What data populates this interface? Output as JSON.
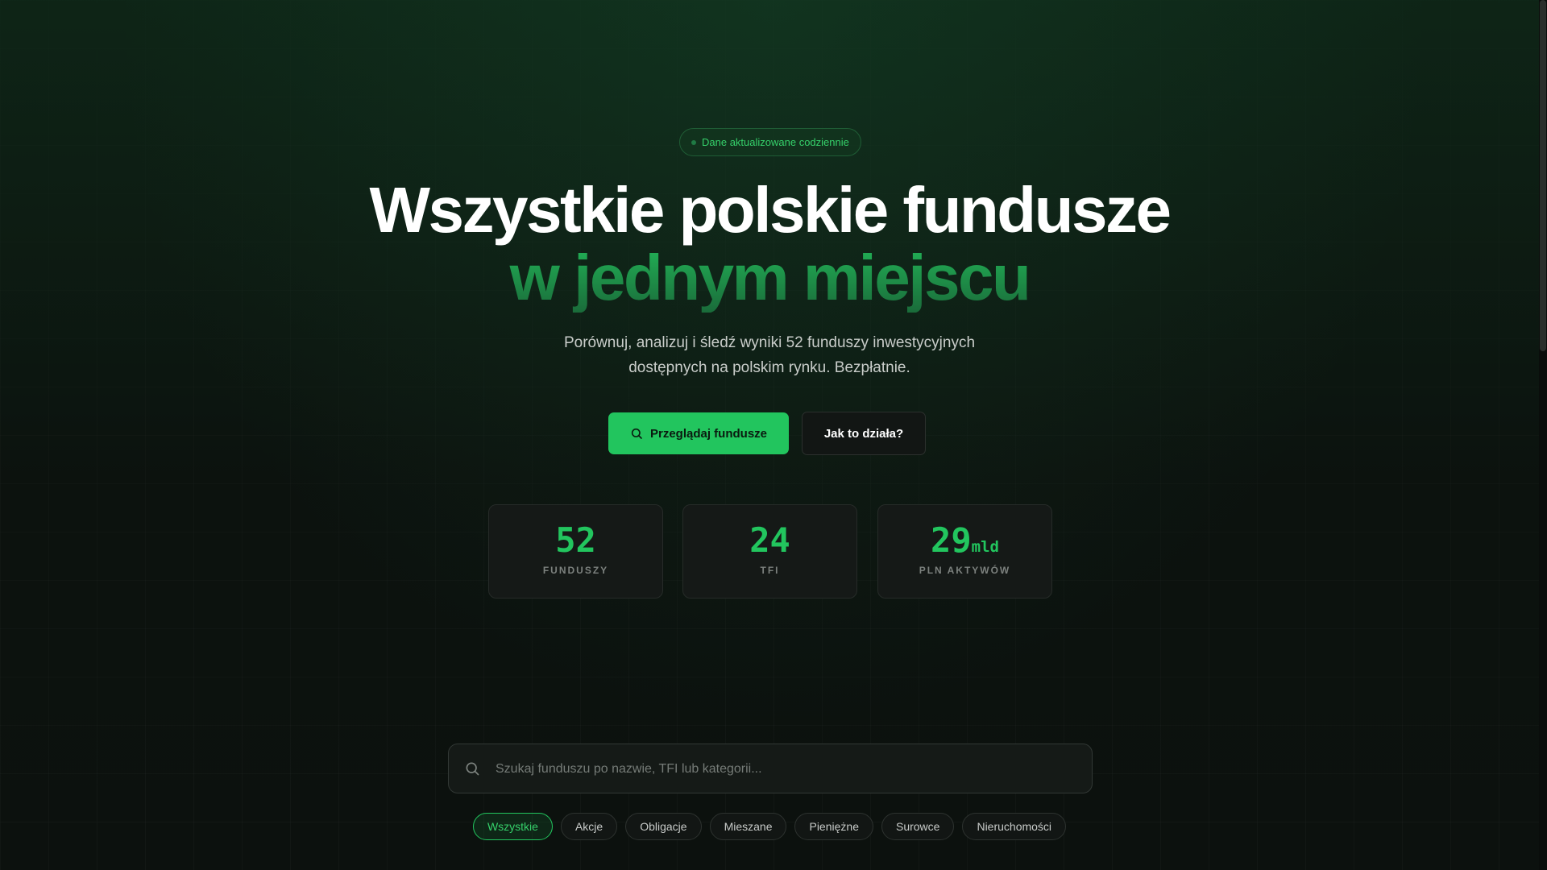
{
  "badge": {
    "text": "Dane aktualizowane codziennie"
  },
  "hero": {
    "title_line1": "Wszystkie polskie fundusze",
    "title_line2": "w jednym miejscu",
    "subtitle_line1": "Porównuj, analizuj i śledź wyniki 52 funduszy inwestycyjnych",
    "subtitle_line2": "dostępnych na polskim rynku. Bezpłatnie."
  },
  "buttons": {
    "primary_label": "Przeglądaj fundusze",
    "secondary_label": "Jak to działa?"
  },
  "stats": [
    {
      "value": "52",
      "unit": "",
      "label": "FUNDUSZY"
    },
    {
      "value": "24",
      "unit": "",
      "label": "TFI"
    },
    {
      "value": "29",
      "unit": "mld",
      "label": "PLN AKTYWÓW"
    }
  ],
  "search": {
    "placeholder": "Szukaj funduszu po nazwie, TFI lub kategorii...",
    "value": ""
  },
  "filters": {
    "items": [
      "Wszystkie",
      "Akcje",
      "Obligacje",
      "Mieszane",
      "Pieniężne",
      "Surowce",
      "Nieruchomości"
    ],
    "selected": "Wszystkie"
  },
  "colors": {
    "accent": "#22c55e",
    "background": "#0c110e",
    "card": "#151917"
  },
  "icons": {
    "primary_button": "search-icon",
    "search_field": "search-icon"
  }
}
